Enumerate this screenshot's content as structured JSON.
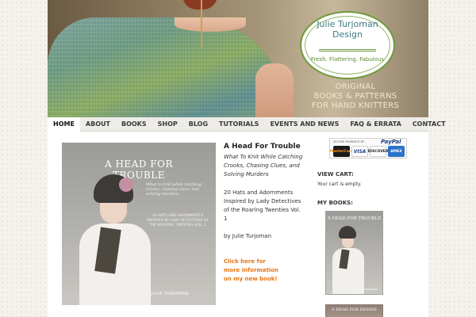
{
  "brand": {
    "logo_name_line1": "Julie Turjoman",
    "logo_name_line2": "Design",
    "logo_tagline": "Fresh. Flattering. Fabulous",
    "banner_tagline_1": "ORIGINAL",
    "banner_tagline_2": "BOOKS & PATTERNS",
    "banner_tagline_3": "FOR HAND KNITTERS"
  },
  "nav": {
    "items": [
      {
        "label": "HOME",
        "active": true
      },
      {
        "label": "ABOUT"
      },
      {
        "label": "BOOKS"
      },
      {
        "label": "SHOP"
      },
      {
        "label": "BLOG"
      },
      {
        "label": "TUTORIALS"
      },
      {
        "label": "EVENTS AND NEWS"
      },
      {
        "label": "FAQ & ERRATA"
      },
      {
        "label": "CONTACT"
      }
    ]
  },
  "book": {
    "cover_title_1": "A HEAD FOR",
    "cover_title_2": "TROUBLE",
    "cover_subtitle": "What to knit while catching crooks, chasing clues, and solving murders",
    "cover_desc": "20 HATS AND ADORNMENTS INSPIRED BY LADY DETECTIVES OF THE ROARING TWENTIES VOL. 1",
    "cover_author": "JULIE TURJOMAN",
    "title": "A Head For Trouble",
    "subtitle": "What To Knit While Catching Crooks, Chasing Clues, and Solving Murders",
    "description": "20 Hats and Adornments Inspired by Lady Detectives of the Roaring Twenties Vol. 1",
    "author": "by Julie Turjoman",
    "link_line1": "Click here for",
    "link_line2": "more information",
    "link_line3": "on my new book!"
  },
  "sidebar": {
    "secure_label": "SECURE PAYMENTS BY",
    "paypal": "PayPal",
    "cards": [
      "MasterCard",
      "VISA",
      "DISCOVER",
      "AMEX"
    ],
    "view_cart_heading": "VIEW CART:",
    "cart_status": "Your cart is empty.",
    "my_books_heading": "MY BOOKS:",
    "side_cover_title": "A HEAD FOR TROUBLE",
    "side_cover_author": "JULIE TURJOMAN",
    "side_cover2_title": "A HEAD FOR DESIGN"
  }
}
